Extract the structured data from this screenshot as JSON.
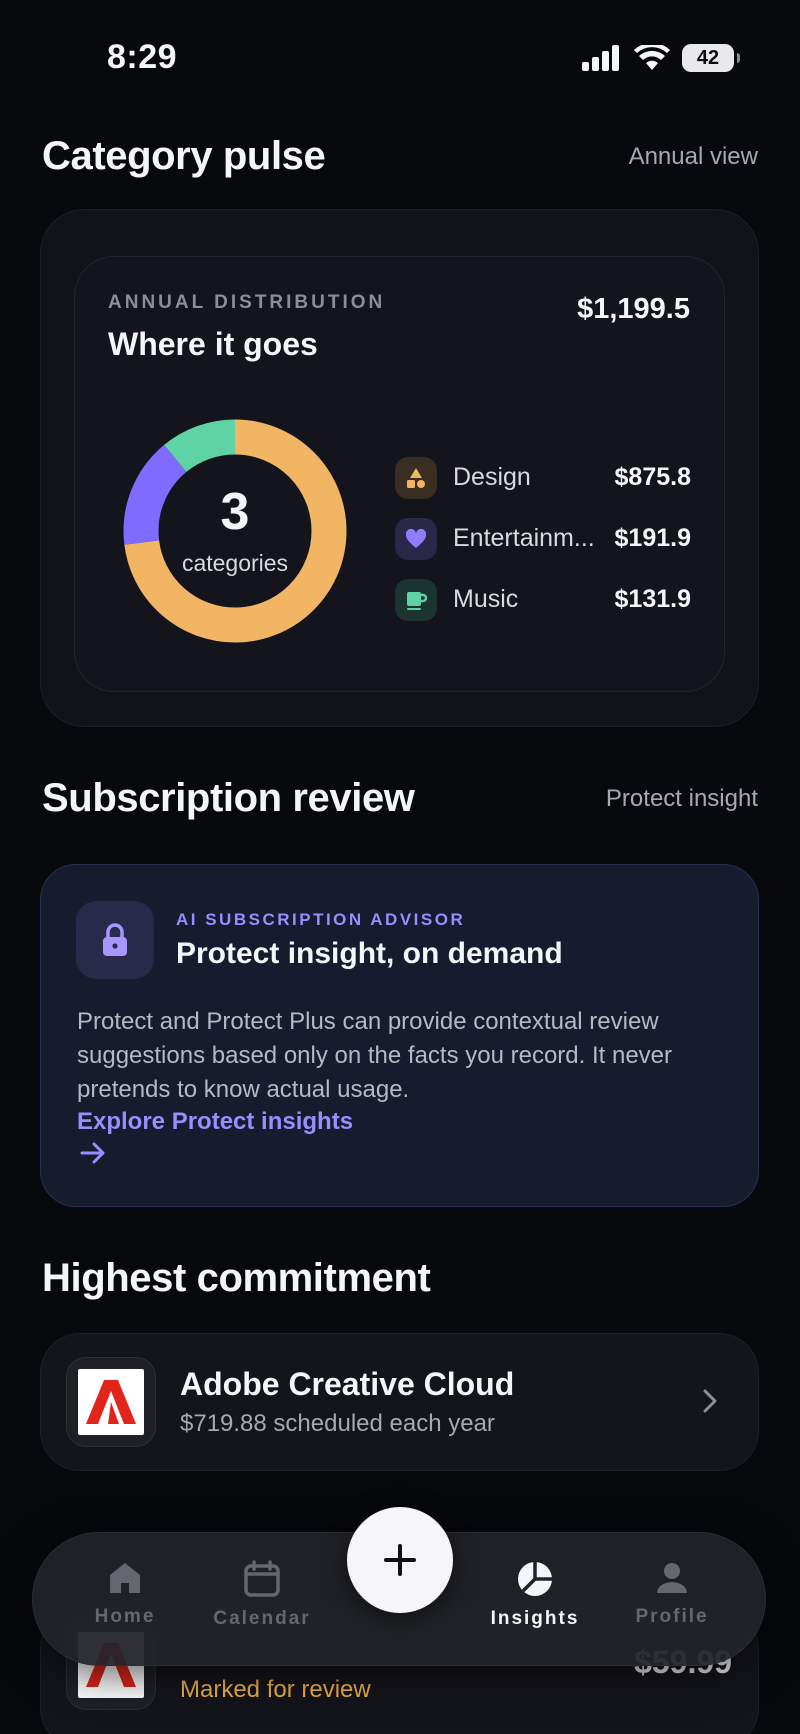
{
  "status_bar": {
    "time": "8:29",
    "battery": "42"
  },
  "category_pulse": {
    "title": "Category pulse",
    "link": "Annual view",
    "overline": "ANNUAL DISTRIBUTION",
    "card_title": "Where it goes",
    "total": "$1,199.5",
    "donut": {
      "count": "3",
      "label": "categories"
    },
    "categories": [
      {
        "name": "Design",
        "value": "$875.8",
        "amount": 875.8,
        "color": "#f2b563",
        "icon": "shapes-icon"
      },
      {
        "name": "Entertainm...",
        "value": "$191.9",
        "amount": 191.9,
        "color": "#7f6bff",
        "icon": "heart-icon"
      },
      {
        "name": "Music",
        "value": "$131.9",
        "amount": 131.9,
        "color": "#5fd3a6",
        "icon": "cup-icon"
      }
    ]
  },
  "subscription_review": {
    "title": "Subscription review",
    "link": "Protect insight",
    "advisor": {
      "overline": "AI SUBSCRIPTION ADVISOR",
      "title": "Protect insight, on demand",
      "body": "Protect and Protect Plus can provide contextual review suggestions based only on the facts you record. It never pretends to know actual usage.",
      "cta": "Explore Protect insights"
    }
  },
  "highest_commitment": {
    "title": "Highest commitment",
    "app_name": "Adobe Creative Cloud",
    "subtitle": "$719.88 scheduled each year"
  },
  "review_item": {
    "price": "$59.99",
    "status": "Marked for review"
  },
  "tabbar": {
    "tabs": [
      {
        "label": "Home"
      },
      {
        "label": "Calendar"
      },
      {
        "label": "Insights"
      },
      {
        "label": "Profile"
      }
    ]
  }
}
